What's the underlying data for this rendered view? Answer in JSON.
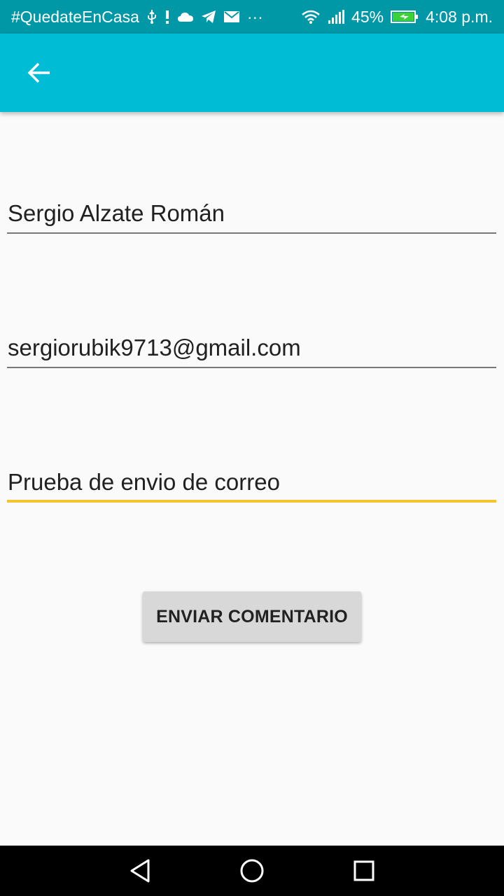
{
  "status_bar": {
    "hashtag": "#QuedateEnCasa",
    "more": "···",
    "battery_percent": "45%",
    "time": "4:08 p.m.",
    "icons": [
      "usb-icon",
      "alert-icon",
      "cloud-icon",
      "telegram-icon",
      "mail-icon",
      "wifi-icon",
      "signal-icon",
      "battery-charging-icon"
    ]
  },
  "toolbar": {
    "back_icon": "arrow-back-icon",
    "color": "#00bcd4"
  },
  "form": {
    "name_value": "Sergio Alzate Román",
    "email_value": "sergiorubik9713@gmail.com",
    "comment_value": "Prueba de envio de correo",
    "focused_field": "comment",
    "focus_color": "#f5c330"
  },
  "send_button": {
    "label": "ENVIAR COMENTARIO"
  },
  "nav_bar": {
    "icons": [
      "back-triangle-icon",
      "home-circle-icon",
      "recents-square-icon"
    ]
  }
}
